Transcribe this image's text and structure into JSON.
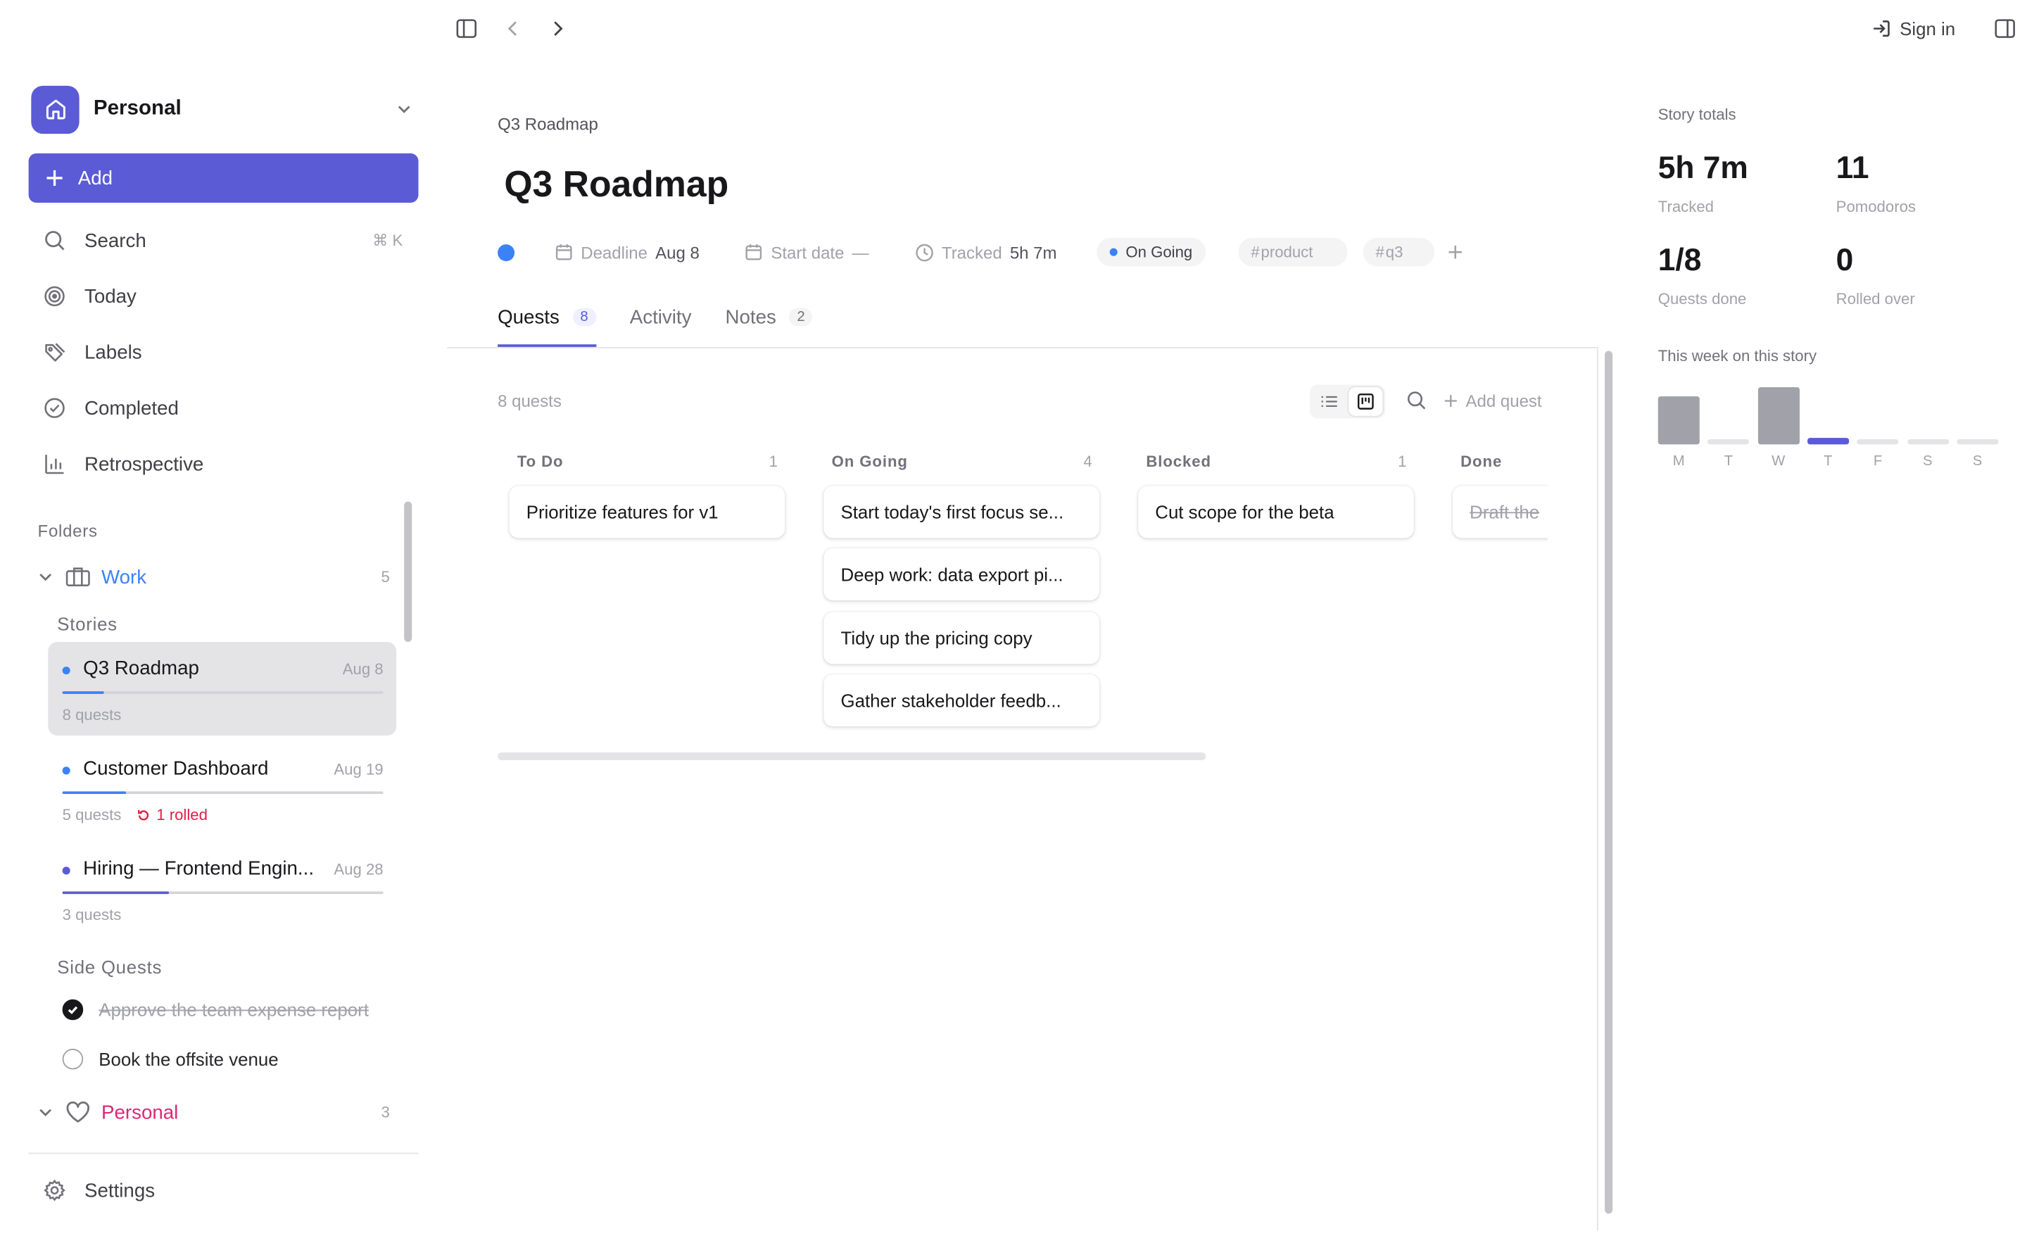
{
  "topbar": {
    "sign_in": "Sign in"
  },
  "workspace": {
    "name": "Personal",
    "accent": "#5b5bd6"
  },
  "sidebar": {
    "add_label": "Add",
    "nav": [
      {
        "label": "Search",
        "shortcut": "⌘ K",
        "icon": "search-icon"
      },
      {
        "label": "Today",
        "icon": "target-icon"
      },
      {
        "label": "Labels",
        "icon": "tag-icon"
      },
      {
        "label": "Completed",
        "icon": "check-circle-icon"
      },
      {
        "label": "Retrospective",
        "icon": "bar-chart-icon"
      }
    ],
    "folders_label": "Folders",
    "work": {
      "name": "Work",
      "count": "5",
      "color": "#3b82f6",
      "stories_label": "Stories",
      "stories": [
        {
          "name": "Q3 Roadmap",
          "date": "Aug 8",
          "quests": "8 quests",
          "progress": 0.13,
          "dot": "#3b82f6"
        },
        {
          "name": "Customer Dashboard",
          "date": "Aug 19",
          "quests": "5 quests",
          "rolled": "1 rolled",
          "progress": 0.2,
          "dot": "#3b82f6"
        },
        {
          "name": "Hiring — Frontend Engin...",
          "date": "Aug 28",
          "quests": "3 quests",
          "progress": 0.33,
          "dot": "#5b5bd6"
        }
      ],
      "side_quests_label": "Side Quests",
      "side_quests": [
        {
          "label": "Approve the team expense report",
          "done": true
        },
        {
          "label": "Book the offsite venue",
          "done": false
        }
      ]
    },
    "personal": {
      "name": "Personal",
      "count": "3",
      "color": "#db2777"
    },
    "settings_label": "Settings"
  },
  "story": {
    "breadcrumb": "Q3 Roadmap",
    "title": "Q3 Roadmap",
    "color": "#3b82f6",
    "deadline_label": "Deadline",
    "deadline_value": "Aug 8",
    "start_label": "Start date",
    "start_value": "—",
    "tracked_label": "Tracked",
    "tracked_value": "5h 7m",
    "status": "On Going",
    "status_color": "#3b82f6",
    "tags": [
      "product",
      "q3"
    ]
  },
  "tabs": [
    {
      "label": "Quests",
      "count": "8",
      "active": true
    },
    {
      "label": "Activity",
      "count": "",
      "active": false
    },
    {
      "label": "Notes",
      "count": "2",
      "active": false
    }
  ],
  "board": {
    "quest_count": "8 quests",
    "add_quest": "Add quest",
    "columns": [
      {
        "name": "To Do",
        "count": "1",
        "cards": [
          {
            "title": "Prioritize features for v1"
          }
        ]
      },
      {
        "name": "On Going",
        "count": "4",
        "cards": [
          {
            "title": "Start today's first focus se..."
          },
          {
            "title": "Deep work: data export pi..."
          },
          {
            "title": "Tidy up the pricing copy"
          },
          {
            "title": "Gather stakeholder feedb..."
          }
        ]
      },
      {
        "name": "Blocked",
        "count": "1",
        "cards": [
          {
            "title": "Cut scope for the beta"
          }
        ]
      },
      {
        "name": "Done",
        "count": "",
        "cards": [
          {
            "title": "Draft the",
            "done": true
          }
        ]
      }
    ]
  },
  "totals": {
    "label": "Story totals",
    "tracked_value": "5h 7m",
    "tracked_label": "Tracked",
    "pomodoros_value": "11",
    "pomodoros_label": "Pomodoros",
    "quests_value": "1/8",
    "quests_label": "Quests done",
    "rolled_value": "0",
    "rolled_label": "Rolled over"
  },
  "week": {
    "label": "This week on this story",
    "days": [
      "M",
      "T",
      "W",
      "T",
      "F",
      "S",
      "S"
    ],
    "values": [
      0.84,
      0.08,
      1.0,
      0.12,
      0.08,
      0.08,
      0.08
    ],
    "today_index": 3,
    "colors": {
      "past": "#a1a1aa",
      "empty": "#e4e4e7",
      "today": "#5b5bd6"
    }
  }
}
